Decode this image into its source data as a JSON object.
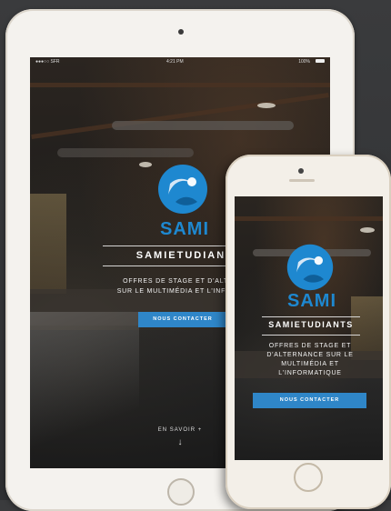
{
  "colors": {
    "accent": "#1e88d0",
    "button": "#2f86c8",
    "device_frame": "#f4f2ee"
  },
  "ipad": {
    "status": {
      "carrier": "●●●○○ SFR",
      "wifi_icon": "wifi-icon",
      "time": "4:21 PM",
      "battery": "100%"
    },
    "logo_text": "SAMI",
    "brand": "SAMIETUDIANTS",
    "tagline": [
      "OFFRES DE STAGE ET D'ALTERNANCE",
      "SUR LE MULTIMÉDIA ET L'INFORMATIQUE"
    ],
    "cta_label": "NOUS CONTACTER",
    "more_label": "EN SAVOIR +",
    "arrow": "↓"
  },
  "iphone": {
    "logo_text": "SAMI",
    "brand": "SAMIETUDIANTS",
    "tagline": [
      "OFFRES DE STAGE ET",
      "D'ALTERNANCE SUR LE",
      "MULTIMÉDIA ET",
      "L'INFORMATIQUE"
    ],
    "cta_label": "NOUS CONTACTER"
  }
}
